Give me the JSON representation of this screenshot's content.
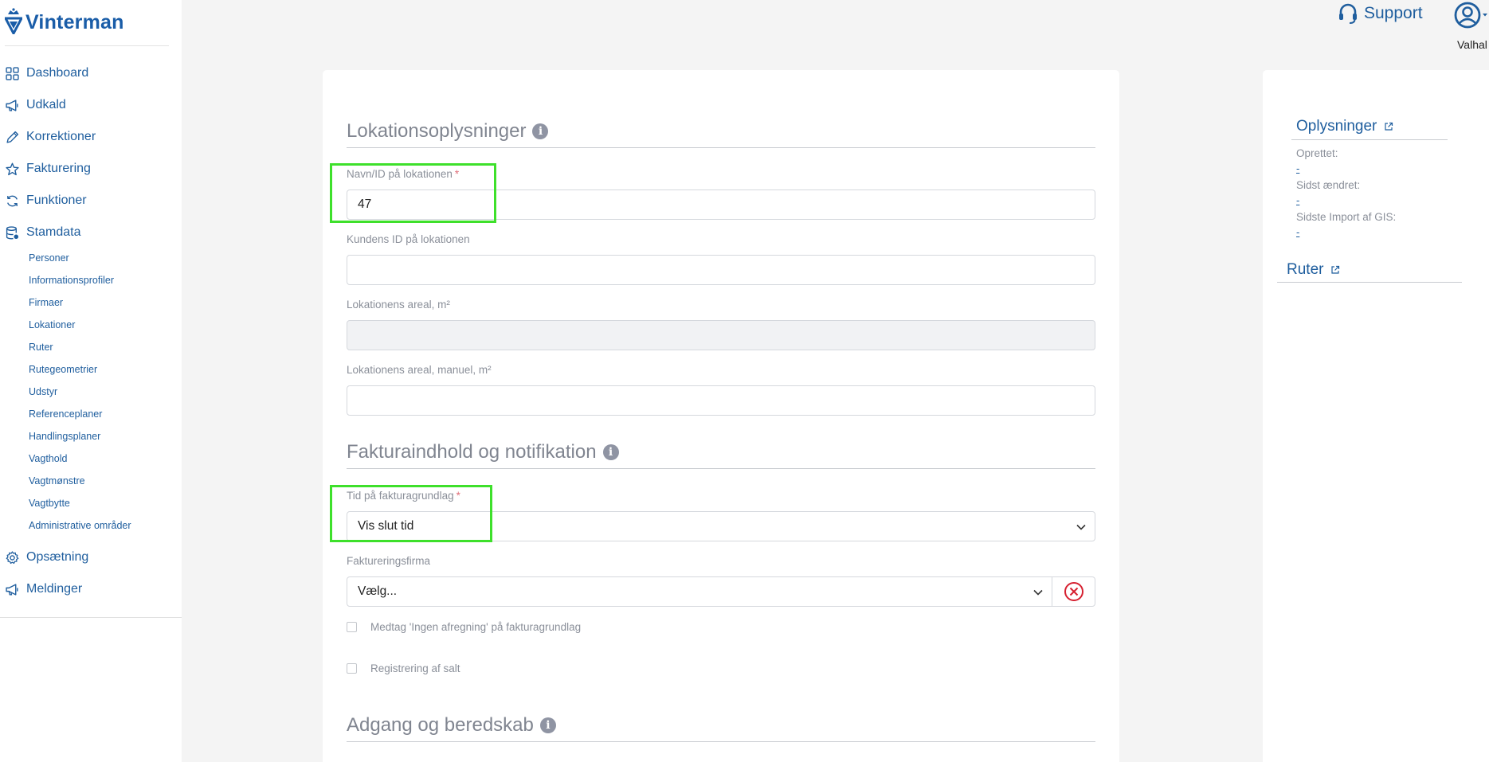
{
  "brand": {
    "name": "Vinterman"
  },
  "sidebar": {
    "items": [
      {
        "label": "Dashboard",
        "icon": "grid-icon"
      },
      {
        "label": "Udkald",
        "icon": "megaphone-icon"
      },
      {
        "label": "Korrektioner",
        "icon": "pencil-icon"
      },
      {
        "label": "Fakturering",
        "icon": "star-icon"
      },
      {
        "label": "Funktioner",
        "icon": "refresh-icon"
      },
      {
        "label": "Stamdata",
        "icon": "database-icon"
      }
    ],
    "subitems": [
      "Personer",
      "Informationsprofiler",
      "Firmaer",
      "Lokationer",
      "Ruter",
      "Rutegeometrier",
      "Udstyr",
      "Referenceplaner",
      "Handlingsplaner",
      "Vagthold",
      "Vagtmønstre",
      "Vagtbytte",
      "Administrative områder"
    ],
    "bottom_items": [
      {
        "label": "Opsætning",
        "icon": "gear-icon"
      },
      {
        "label": "Meldinger",
        "icon": "megaphone-icon"
      }
    ]
  },
  "header": {
    "support_label": "Support",
    "user_name": "Valhal"
  },
  "form": {
    "section1": {
      "title": "Lokationsoplysninger",
      "name_label": "Navn/ID på lokationen",
      "required_mark": "*",
      "name_value": "47",
      "customer_id_label": "Kundens ID på lokationen",
      "customer_id_value": "",
      "area_label": "Lokationens areal, m²",
      "area_value": "",
      "area_manual_label": "Lokationens areal, manuel, m²",
      "area_manual_value": ""
    },
    "section2": {
      "title": "Fakturaindhold og notifikation",
      "time_label": "Tid på fakturagrundlag",
      "time_value": "Vis slut tid",
      "firm_label": "Faktureringsfirma",
      "firm_value": "Vælg...",
      "check1_label": "Medtag 'Ingen afregning' på fakturagrundlag",
      "check2_label": "Registrering af salt"
    },
    "section3": {
      "title": "Adgang og beredskab"
    },
    "info_glyph": "i"
  },
  "right_panel": {
    "info_title": "Oplysninger",
    "created_label": "Oprettet:",
    "created_value": "-",
    "changed_label": "Sidst ændret:",
    "changed_value": "-",
    "gis_label": "Sidste Import af GIS:",
    "gis_value": "-",
    "routes_title": "Ruter"
  },
  "colors": {
    "accent": "#1f5e9e",
    "highlight": "#3ee02b",
    "error": "#d62030"
  }
}
